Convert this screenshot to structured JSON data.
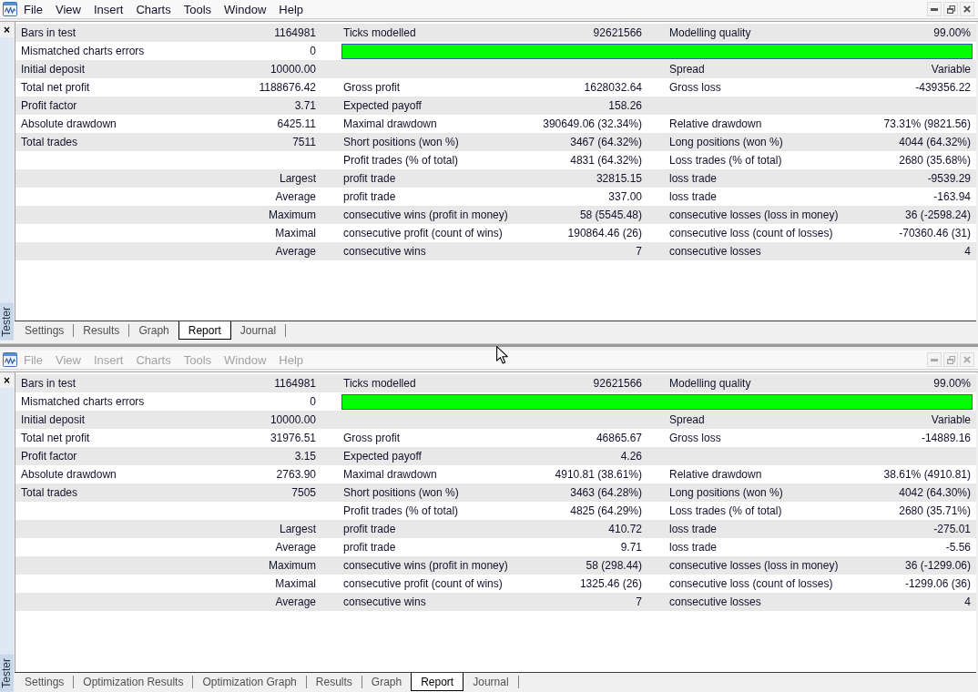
{
  "windows": [
    {
      "active": true,
      "menu": [
        "File",
        "View",
        "Insert",
        "Charts",
        "Tools",
        "Window",
        "Help"
      ],
      "panel": {
        "close": "×",
        "title": "Tester"
      },
      "report_rows": [
        {
          "col_1": {
            "label": "Bars in test",
            "value": "1164981"
          },
          "col_2": {
            "label": "Ticks modelled",
            "value": "92621566"
          },
          "col_3": {
            "label": "Modelling quality",
            "value": "99.00%"
          }
        },
        {
          "col_1": {
            "label": "Mismatched charts errors",
            "value": "0"
          },
          "quality_bar": true
        },
        {
          "col_1": {
            "label": "Initial deposit",
            "value": "10000.00"
          },
          "col_3": {
            "label": "Spread",
            "value": "Variable"
          }
        },
        {
          "col_1": {
            "label": "Total net profit",
            "value": "1188676.42"
          },
          "col_2": {
            "label": "Gross profit",
            "value": "1628032.64"
          },
          "col_3": {
            "label": "Gross loss",
            "value": "-439356.22"
          }
        },
        {
          "col_1": {
            "label": "Profit factor",
            "value": "3.71"
          },
          "col_2": {
            "label": "Expected payoff",
            "value": "158.26"
          }
        },
        {
          "col_1": {
            "label": "Absolute drawdown",
            "value": "6425.11"
          },
          "col_2": {
            "label": "Maximal drawdown",
            "value": "390649.06 (32.34%)"
          },
          "col_3": {
            "label": "Relative drawdown",
            "value": "73.31% (9821.56)"
          }
        },
        {
          "col_1": {
            "label": "Total trades",
            "value": "7511"
          },
          "col_2": {
            "label": "Short positions (won %)",
            "value": "3467 (64.32%)"
          },
          "col_3": {
            "label": "Long positions (won %)",
            "value": "4044 (64.32%)"
          }
        },
        {
          "col_2": {
            "label": "Profit trades (% of total)",
            "value": "4831 (64.32%)"
          },
          "col_3": {
            "label": "Loss trades (% of total)",
            "value": "2680 (35.68%)"
          }
        },
        {
          "col_1": {
            "qualifier": "Largest"
          },
          "col_2": {
            "label": "profit trade",
            "value": "32815.15"
          },
          "col_3": {
            "label": "loss trade",
            "value": "-9539.29"
          }
        },
        {
          "col_1": {
            "qualifier": "Average"
          },
          "col_2": {
            "label": "profit trade",
            "value": "337.00"
          },
          "col_3": {
            "label": "loss trade",
            "value": "-163.94"
          }
        },
        {
          "col_1": {
            "qualifier": "Maximum"
          },
          "col_2": {
            "label": "consecutive wins (profit in money)",
            "value": "58 (5545.48)"
          },
          "col_3": {
            "label": "consecutive losses (loss in money)",
            "value": "36 (-2598.24)"
          }
        },
        {
          "col_1": {
            "qualifier": "Maximal"
          },
          "col_2": {
            "label": "consecutive profit (count of wins)",
            "value": "190864.46 (26)"
          },
          "col_3": {
            "label": "consecutive loss (count of losses)",
            "value": "-70360.46 (31)"
          }
        },
        {
          "col_1": {
            "qualifier": "Average"
          },
          "col_2": {
            "label": "consecutive wins",
            "value": "7"
          },
          "col_3": {
            "label": "consecutive losses",
            "value": "4"
          }
        }
      ],
      "tabs": [
        {
          "label": "Settings",
          "selected": false
        },
        {
          "label": "Results",
          "selected": false
        },
        {
          "label": "Graph",
          "selected": false
        },
        {
          "label": "Report",
          "selected": true
        },
        {
          "label": "Journal",
          "selected": false
        }
      ]
    },
    {
      "active": false,
      "menu": [
        "File",
        "View",
        "Insert",
        "Charts",
        "Tools",
        "Window",
        "Help"
      ],
      "panel": {
        "close": "×",
        "title": "Tester"
      },
      "report_rows": [
        {
          "col_1": {
            "label": "Bars in test",
            "value": "1164981"
          },
          "col_2": {
            "label": "Ticks modelled",
            "value": "92621566"
          },
          "col_3": {
            "label": "Modelling quality",
            "value": "99.00%"
          }
        },
        {
          "col_1": {
            "label": "Mismatched charts errors",
            "value": "0"
          },
          "quality_bar": true
        },
        {
          "col_1": {
            "label": "Initial deposit",
            "value": "10000.00"
          },
          "col_3": {
            "label": "Spread",
            "value": "Variable"
          }
        },
        {
          "col_1": {
            "label": "Total net profit",
            "value": "31976.51"
          },
          "col_2": {
            "label": "Gross profit",
            "value": "46865.67"
          },
          "col_3": {
            "label": "Gross loss",
            "value": "-14889.16"
          }
        },
        {
          "col_1": {
            "label": "Profit factor",
            "value": "3.15"
          },
          "col_2": {
            "label": "Expected payoff",
            "value": "4.26"
          }
        },
        {
          "col_1": {
            "label": "Absolute drawdown",
            "value": "2763.90"
          },
          "col_2": {
            "label": "Maximal drawdown",
            "value": "4910.81 (38.61%)"
          },
          "col_3": {
            "label": "Relative drawdown",
            "value": "38.61% (4910.81)"
          }
        },
        {
          "col_1": {
            "label": "Total trades",
            "value": "7505"
          },
          "col_2": {
            "label": "Short positions (won %)",
            "value": "3463 (64.28%)"
          },
          "col_3": {
            "label": "Long positions (won %)",
            "value": "4042 (64.30%)"
          }
        },
        {
          "col_2": {
            "label": "Profit trades (% of total)",
            "value": "4825 (64.29%)"
          },
          "col_3": {
            "label": "Loss trades (% of total)",
            "value": "2680 (35.71%)"
          }
        },
        {
          "col_1": {
            "qualifier": "Largest"
          },
          "col_2": {
            "label": "profit trade",
            "value": "410.72"
          },
          "col_3": {
            "label": "loss trade",
            "value": "-275.01"
          }
        },
        {
          "col_1": {
            "qualifier": "Average"
          },
          "col_2": {
            "label": "profit trade",
            "value": "9.71"
          },
          "col_3": {
            "label": "loss trade",
            "value": "-5.56"
          }
        },
        {
          "col_1": {
            "qualifier": "Maximum"
          },
          "col_2": {
            "label": "consecutive wins (profit in money)",
            "value": "58 (298.44)"
          },
          "col_3": {
            "label": "consecutive losses (loss in money)",
            "value": "36 (-1299.06)"
          }
        },
        {
          "col_1": {
            "qualifier": "Maximal"
          },
          "col_2": {
            "label": "consecutive profit (count of wins)",
            "value": "1325.46 (26)"
          },
          "col_3": {
            "label": "consecutive loss (count of losses)",
            "value": "-1299.06 (36)"
          }
        },
        {
          "col_1": {
            "qualifier": "Average"
          },
          "col_2": {
            "label": "consecutive wins",
            "value": "7"
          },
          "col_3": {
            "label": "consecutive losses",
            "value": "4"
          }
        }
      ],
      "tabs": [
        {
          "label": "Settings",
          "selected": false
        },
        {
          "label": "Optimization Results",
          "selected": false
        },
        {
          "label": "Optimization Graph",
          "selected": false
        },
        {
          "label": "Results",
          "selected": false
        },
        {
          "label": "Graph",
          "selected": false
        },
        {
          "label": "Report",
          "selected": true
        },
        {
          "label": "Journal",
          "selected": false
        }
      ]
    }
  ]
}
